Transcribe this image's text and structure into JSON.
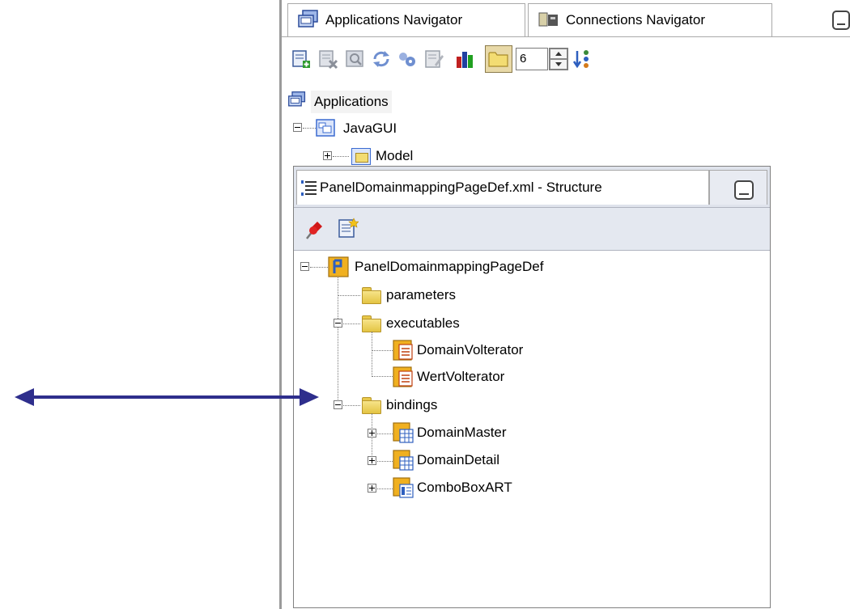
{
  "top_tabs": {
    "applications_navigator": "Applications Navigator",
    "connections_navigator": "Connections Navigator"
  },
  "toolbar": {
    "level_value": "6",
    "icons": [
      "new-icon",
      "delete-icon",
      "find-icon",
      "refresh-icon",
      "edit-icon",
      "chart-icon",
      "folder-toggle-icon",
      "level-spinner",
      "sort-icon"
    ]
  },
  "app_tree": {
    "root": "Applications",
    "project": "JavaGUI",
    "child": "Model"
  },
  "structure": {
    "tab_title": "PanelDomainmappingPageDef.xml - Structure",
    "root": "PanelDomainmappingPageDef",
    "parameters": "parameters",
    "executables": "executables",
    "exec_items": [
      "DomainVolterator",
      "WertVolterator"
    ],
    "bindings": "bindings",
    "binding_items": [
      "DomainMaster",
      "DomainDetail",
      "ComboBoxART"
    ]
  },
  "colors": {
    "arrow": "#2e2e8c",
    "panel_header": "#dfe3ec",
    "folder": "#e8c84a"
  }
}
